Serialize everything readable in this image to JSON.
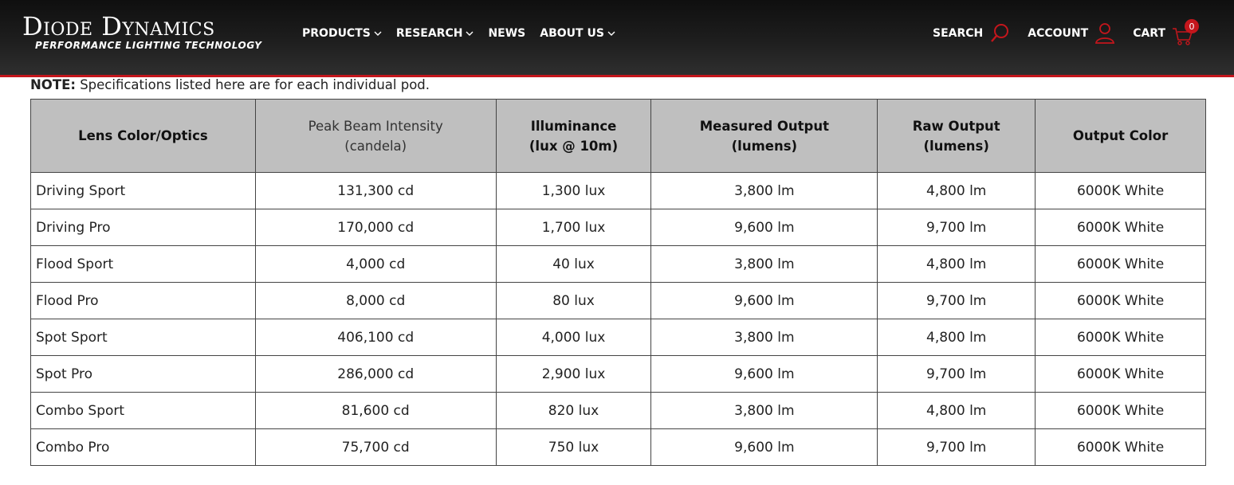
{
  "header": {
    "logo_main": "Diode Dynamics",
    "logo_sub": "PERFORMANCE LIGHTING TECHNOLOGY",
    "nav": [
      {
        "label": "PRODUCTS"
      },
      {
        "label": "RESEARCH"
      },
      {
        "label": "NEWS"
      },
      {
        "label": "ABOUT US"
      }
    ],
    "search_label": "SEARCH",
    "account_label": "ACCOUNT",
    "cart_label": "CART",
    "cart_count": "0",
    "accent_color": "#c4161c"
  },
  "note": {
    "prefix": "NOTE:",
    "text": " Specifications listed here are for each individual pod."
  },
  "table": {
    "headers": [
      {
        "line1": "Lens Color/Optics",
        "line2": ""
      },
      {
        "line1": "Peak Beam Intensity",
        "line2": "(candela)"
      },
      {
        "line1": "Illuminance",
        "line2": "(lux @ 10m)"
      },
      {
        "line1": "Measured Output",
        "line2": "(lumens)"
      },
      {
        "line1": "Raw Output",
        "line2": "(lumens)"
      },
      {
        "line1": "Output Color",
        "line2": ""
      }
    ],
    "rows": [
      [
        "Driving Sport",
        "131,300 cd",
        "1,300 lux",
        "3,800 lm",
        "4,800 lm",
        "6000K White"
      ],
      [
        "Driving Pro",
        "170,000 cd",
        "1,700 lux",
        "9,600 lm",
        "9,700 lm",
        "6000K White"
      ],
      [
        "Flood Sport",
        "4,000 cd",
        "40 lux",
        "3,800 lm",
        "4,800 lm",
        "6000K White"
      ],
      [
        "Flood Pro",
        "8,000 cd",
        "80 lux",
        "9,600 lm",
        "9,700 lm",
        "6000K White"
      ],
      [
        "Spot Sport",
        "406,100 cd",
        "4,000 lux",
        "3,800 lm",
        "4,800 lm",
        "6000K White"
      ],
      [
        "Spot Pro",
        "286,000 cd",
        "2,900 lux",
        "9,600 lm",
        "9,700 lm",
        "6000K White"
      ],
      [
        "Combo Sport",
        "81,600 cd",
        "820 lux",
        "3,800 lm",
        "4,800 lm",
        "6000K White"
      ],
      [
        "Combo Pro",
        "75,700 cd",
        "750 lux",
        "9,600 lm",
        "9,700 lm",
        "6000K White"
      ]
    ]
  }
}
